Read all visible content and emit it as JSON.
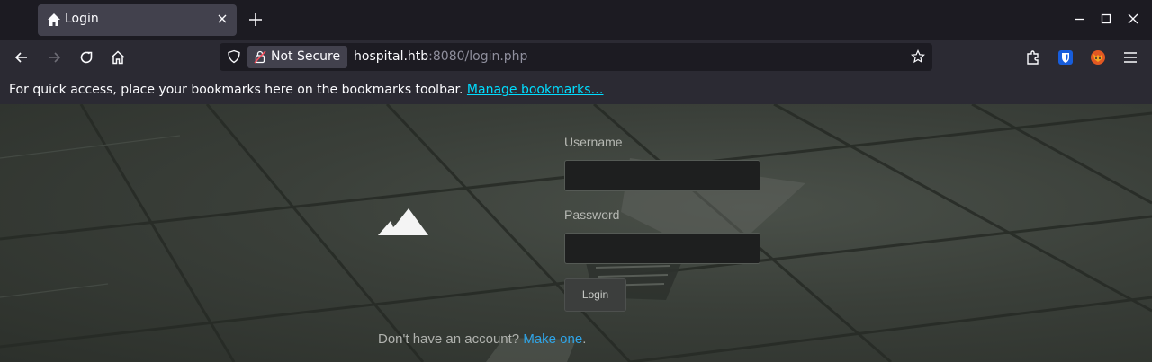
{
  "tabbar": {
    "tab_title": "Login",
    "tab_icon": "home-icon"
  },
  "navbar": {
    "security_label": "Not Secure",
    "url_host": "hospital.htb",
    "url_rest": ":8080/login.php"
  },
  "bookmarks": {
    "text": "For quick access, place your bookmarks here on the bookmarks toolbar.",
    "link": "Manage bookmarks…"
  },
  "login": {
    "username_label": "Username",
    "username_value": "",
    "password_label": "Password",
    "password_value": "",
    "button_label": "Login",
    "signup_text": "Don't have an account?",
    "signup_link": "Make one",
    "signup_end": "."
  },
  "colors": {
    "accent_link": "#2fa4e7",
    "bookmark_link": "#00ddff"
  }
}
